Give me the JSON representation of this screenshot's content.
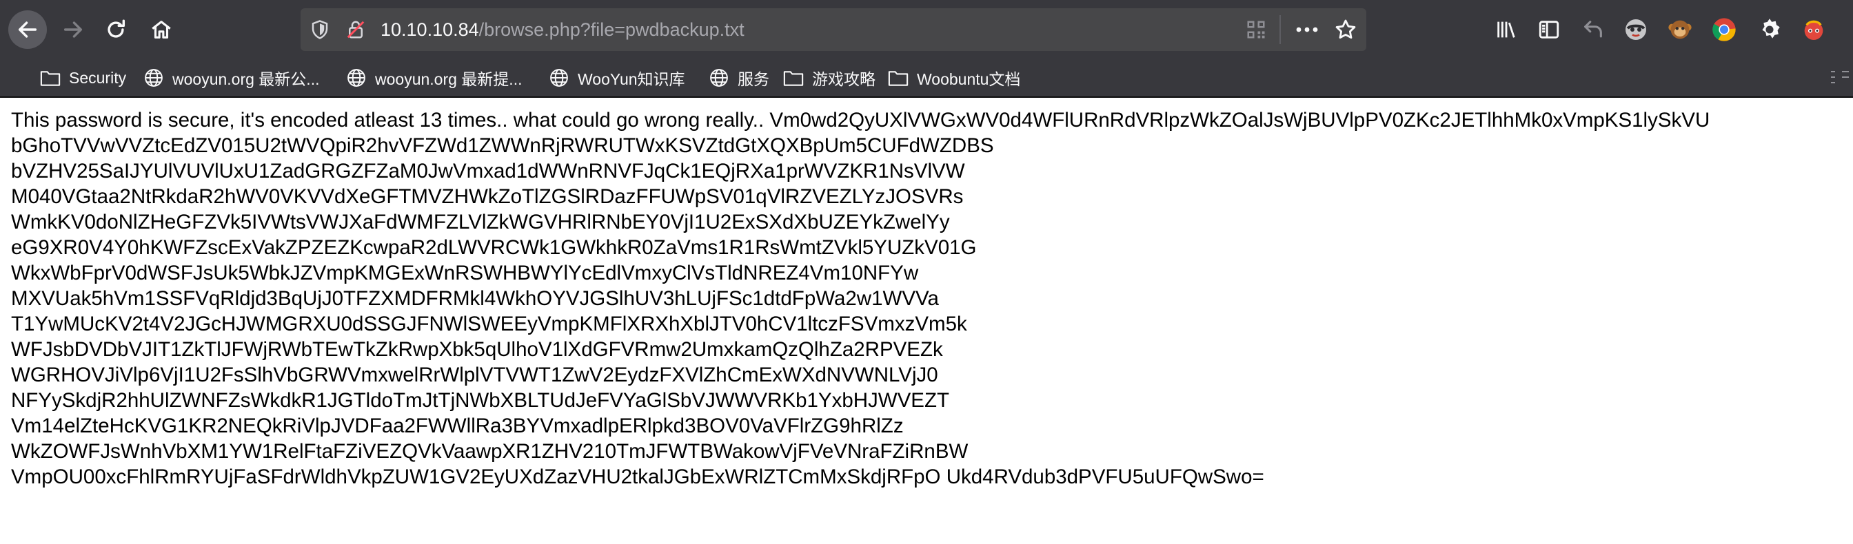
{
  "nav": {
    "back_icon": "arrow-left-icon",
    "forward_icon": "arrow-right-icon",
    "reload_icon": "reload-icon",
    "home_icon": "home-icon"
  },
  "urlbar": {
    "host": "10.10.10.84",
    "path": "/browse.php?file=pwdbackup.txt"
  },
  "toolbar_icons": [
    "library-icon",
    "sidebar-icon",
    "undo-icon",
    "extension-monkey-icon",
    "extension-tampermonkey-icon",
    "chrome-icon",
    "gear-icon",
    "extension-bug-icon"
  ],
  "bookmarks": [
    {
      "label": "Security",
      "icon": "folder-icon"
    },
    {
      "label": "wooyun.org 最新公...",
      "icon": "globe-icon"
    },
    {
      "label": "wooyun.org 最新提...",
      "icon": "globe-icon"
    },
    {
      "label": "WooYun知识库",
      "icon": "globe-icon"
    },
    {
      "label": "服务",
      "icon": "globe-icon"
    },
    {
      "label": "游戏攻略",
      "icon": "folder-icon"
    },
    {
      "label": "Woobuntu文档",
      "icon": "folder-icon"
    }
  ],
  "content_lines": [
    "This password is secure, it's encoded atleast 13 times.. what could go wrong really.. Vm0wd2QyUXlVWGxWV0d4WFlURnRdVRlpzWkZOalJsWjBUVlpPV0ZKc2JETlhhMk0xVmpKS1lySkVU",
    "bGhoTVVwVVZtcEdZV015U2tWVQpiR2hvVFZWd1ZWWnRjRWRUTWxKSVZtdGtXQXBpUm5CUFdWZDBS",
    "bVZHV25SaIJYUlVUVlUxU1ZadGRGZFZaM0JwVmxad1dWWnRNVFJqCk1EQjRXa1prWVZKR1NsVlVW",
    "M040VGtaa2NtRkdaR2hWV0VKVVdXeGFTMVZHWkZoTlZGSlRDazFFUWpSV01qVlRZVEZLYzJOSVRs",
    "WmkKV0doNlZHeGFZVk5IVWtsVWJXaFdWMFZLVlZkWGVHRlRNbEY0VjI1U2ExSXdXbUZEYkZwelYy",
    "eG9XR0V4Y0hKWFZscExVakZPZEZKcwpaR2dLWVRCWk1GWkhkR0ZaVms1R1RsWmtZVkl5YUZkV01G",
    "WkxWbFprV0dWSFJsUk5WbkJZVmpKMGExWnRSWHBWYlYcEdlVmxyClVsTldNREZ4Vm10NFYw",
    "MXVUak5hVm1SSFVqRldjd3BqUjJ0TFZXMDFRMkl4WkhOYVJGSlhUV3hLUjFSc1dtdFpWa2w1WVVa",
    "T1YwMUcKV2t4V2JGcHJWMGRXU0dSSGJFNWlSWEEyVmpKMFlXRXhXblJTV0hCV1ltczFSVmxzVm5k",
    "WFJsbDVDbVJIT1ZkTlJFWjRWbTEwTkZkRwpXbk5qUlhoV1lXdGFVRmw2UmxkamQzQlhZa2RPVEZk",
    "WGRHOVJiVlp6VjI1U2FsSlhVbGRWVmxwelRrWlplVTVWT1ZwV2EydzFXVlZhCmExWXdNVWNLVjJ0",
    "NFYySkdjR2hhUlZWNFZsWkdkR1JGTldoTmJtTjNWbXBLTUdJeFVYaGlSbVJWWVRKb1YxbHJWVEZT",
    "Vm14elZteHcKVG1KR2NEQkRiVlpJVDFaa2FWWllRa3BYVmxadlpERlpkd3BOV0VaVFlrZG9hRlZz",
    "WkZOWFJsWnhVbXM1YW1RelFtaFZiVEZQVkVaawpXR1ZHV210TmJFWTBWakowVjFVeVNraFZiRnBW",
    "VmpOU00xcFhlRmRYUjFaSFdrWldhVkpZUW1GV2EyUXdZazVHU2tkalJGbExWRlZTCmMxSkdjRFpO Ukd4RVdub3dPVFU5uUFQwSwo="
  ]
}
